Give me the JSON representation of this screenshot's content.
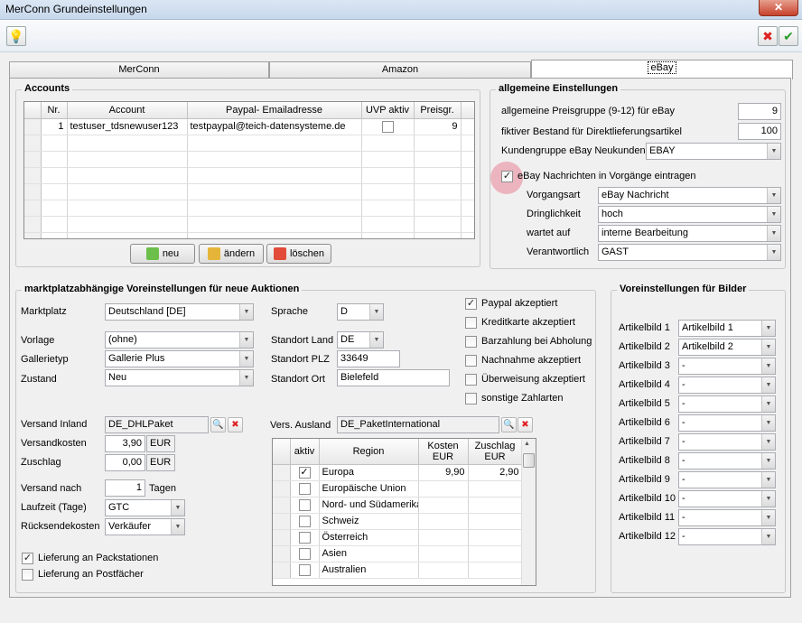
{
  "window": {
    "title": "MerConn Grundeinstellungen",
    "close_glyph": "✕"
  },
  "toolbar": {
    "hint_glyph": "💡",
    "cancel_glyph": "✖",
    "ok_glyph": "✔"
  },
  "tabs": [
    {
      "label": "MerConn"
    },
    {
      "label": "Amazon"
    },
    {
      "label": "eBay"
    }
  ],
  "accounts": {
    "title": "Accounts",
    "headers": [
      "Nr.",
      "Account",
      "Paypal- Emailadresse",
      "UVP aktiv",
      "Preisgr."
    ],
    "rows": [
      {
        "nr": "1",
        "account": "testuser_tdsnewuser123",
        "paypal": "testpaypal@teich-datensysteme.de",
        "uvp": false,
        "preisgr": "9"
      }
    ],
    "buttons": {
      "new": "neu",
      "edit": "ändern",
      "delete": "löschen"
    }
  },
  "general": {
    "title": "allgemeine Einstellungen",
    "preisgruppe_label": "allgemeine Preisgruppe (9-12) für eBay",
    "preisgruppe_value": "9",
    "bestand_label": "fiktiver Bestand für Direktlieferungsartikel",
    "bestand_value": "100",
    "kundengruppe_label": "Kundengruppe eBay Neukunden",
    "kundengruppe_value": "EBAY",
    "nachrichten_label": "eBay Nachrichten in Vorgänge eintragen",
    "nachrichten_checked": true,
    "vorgangsart_label": "Vorgangsart",
    "vorgangsart_value": "eBay Nachricht",
    "dringlichkeit_label": "Dringlichkeit",
    "dringlichkeit_value": "hoch",
    "wartet_label": "wartet auf",
    "wartet_value": "interne Bearbeitung",
    "verantwortlich_label": "Verantwortlich",
    "verantwortlich_value": "GAST"
  },
  "market": {
    "title": "marktplatzabhängige Voreinstellungen für neue Auktionen",
    "marktplatz_label": "Marktplatz",
    "marktplatz_value": "Deutschland [DE]",
    "vorlage_label": "Vorlage",
    "vorlage_value": "(ohne)",
    "gallerietyp_label": "Gallerietyp",
    "gallerietyp_value": "Gallerie Plus",
    "zustand_label": "Zustand",
    "zustand_value": "Neu",
    "sprache_label": "Sprache",
    "sprache_value": "D",
    "standortland_label": "Standort Land",
    "standortland_value": "DE",
    "standortplz_label": "Standort PLZ",
    "standortplz_value": "33649",
    "standortort_label": "Standort Ort",
    "standortort_value": "Bielefeld",
    "payments": [
      {
        "label": "Paypal akzeptiert",
        "checked": true
      },
      {
        "label": "Kreditkarte akzeptiert",
        "checked": false
      },
      {
        "label": "Barzahlung bei Abholung",
        "checked": false
      },
      {
        "label": "Nachnahme akzeptiert",
        "checked": false
      },
      {
        "label": "Überweisung akzeptiert",
        "checked": false
      },
      {
        "label": "sonstige Zahlarten",
        "checked": false
      }
    ],
    "versand_inland_label": "Versand Inland",
    "versand_inland_value": "DE_DHLPaket",
    "versandkosten_label": "Versandkosten",
    "versandkosten_value": "3,90",
    "versandkosten_currency": "EUR",
    "zuschlag_label": "Zuschlag",
    "zuschlag_value": "0,00",
    "zuschlag_currency": "EUR",
    "versand_nach_label": "Versand nach",
    "versand_nach_value": "1",
    "versand_nach_unit": "Tagen",
    "laufzeit_label": "Laufzeit (Tage)",
    "laufzeit_value": "GTC",
    "ruecksende_label": "Rücksendekosten",
    "ruecksende_value": "Verkäufer",
    "packstationen_label": "Lieferung an Packstationen",
    "packstationen_checked": true,
    "postfaecher_label": "Lieferung an Postfächer",
    "postfaecher_checked": false,
    "vers_ausland_label": "Vers. Ausland",
    "vers_ausland_value": "DE_PaketInternational",
    "regions_headers": {
      "aktiv": "aktiv",
      "region": "Region",
      "kosten": "Kosten\nEUR",
      "zuschlag": "Zuschlag\nEUR"
    },
    "regions": [
      {
        "region": "Europa",
        "checked": true,
        "kosten": "9,90",
        "zuschlag": "2,90"
      },
      {
        "region": "Europäische Union",
        "checked": false,
        "kosten": "",
        "zuschlag": ""
      },
      {
        "region": "Nord- und Südamerika",
        "checked": false,
        "kosten": "",
        "zuschlag": ""
      },
      {
        "region": "Schweiz",
        "checked": false,
        "kosten": "",
        "zuschlag": ""
      },
      {
        "region": "Österreich",
        "checked": false,
        "kosten": "",
        "zuschlag": ""
      },
      {
        "region": "Asien",
        "checked": false,
        "kosten": "",
        "zuschlag": ""
      },
      {
        "region": "Australien",
        "checked": false,
        "kosten": "",
        "zuschlag": ""
      }
    ]
  },
  "images": {
    "title": "Voreinstellungen für Bilder",
    "items": [
      {
        "label": "Artikelbild 1",
        "value": "Artikelbild 1"
      },
      {
        "label": "Artikelbild 2",
        "value": "Artikelbild 2"
      },
      {
        "label": "Artikelbild 3",
        "value": "-"
      },
      {
        "label": "Artikelbild 4",
        "value": "-"
      },
      {
        "label": "Artikelbild 5",
        "value": "-"
      },
      {
        "label": "Artikelbild 6",
        "value": "-"
      },
      {
        "label": "Artikelbild 7",
        "value": "-"
      },
      {
        "label": "Artikelbild 8",
        "value": "-"
      },
      {
        "label": "Artikelbild 9",
        "value": "-"
      },
      {
        "label": "Artikelbild 10",
        "value": "-"
      },
      {
        "label": "Artikelbild 11",
        "value": "-"
      },
      {
        "label": "Artikelbild 12",
        "value": "-"
      }
    ]
  },
  "colors": {
    "titlebar": "#c7d8ec",
    "close": "#c7412b",
    "highlight": "#e7788c"
  }
}
